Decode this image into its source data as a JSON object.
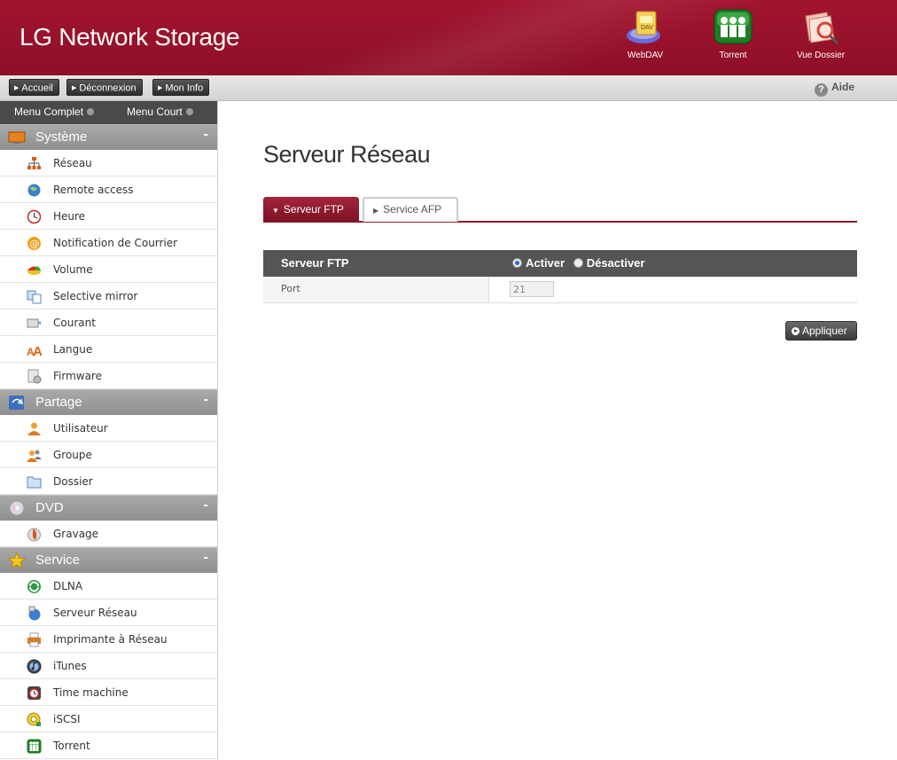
{
  "header": {
    "brand": "LG Network Storage",
    "shortcuts": [
      {
        "label": "WebDAV",
        "icon": "webdav-icon",
        "badge": "DAV"
      },
      {
        "label": "Torrent",
        "icon": "torrent-icon"
      },
      {
        "label": "Vue Dossier",
        "icon": "folder-view-icon"
      }
    ]
  },
  "toolbar": {
    "buttons": [
      "Accueil",
      "Déconnexion",
      "Mon Info"
    ],
    "help": "Aide"
  },
  "sidebar": {
    "menu_full": "Menu Complet",
    "menu_short": "Menu Court",
    "sections": [
      {
        "title": "Système",
        "icon": "monitor-icon",
        "items": [
          {
            "label": "Réseau",
            "icon": "network-icon"
          },
          {
            "label": "Remote access",
            "icon": "globe-icon"
          },
          {
            "label": "Heure",
            "icon": "clock-icon"
          },
          {
            "label": "Notification de Courrier",
            "icon": "at-icon"
          },
          {
            "label": "Volume",
            "icon": "volume-icon"
          },
          {
            "label": "Selective mirror",
            "icon": "mirror-icon"
          },
          {
            "label": "Courant",
            "icon": "power-icon"
          },
          {
            "label": "Langue",
            "icon": "language-icon"
          },
          {
            "label": "Firmware",
            "icon": "firmware-icon"
          }
        ]
      },
      {
        "title": "Partage",
        "icon": "share-icon",
        "items": [
          {
            "label": "Utilisateur",
            "icon": "user-icon"
          },
          {
            "label": "Groupe",
            "icon": "group-icon"
          },
          {
            "label": "Dossier",
            "icon": "folder-icon"
          }
        ]
      },
      {
        "title": "DVD",
        "icon": "disc-icon",
        "items": [
          {
            "label": "Gravage",
            "icon": "burn-icon"
          }
        ]
      },
      {
        "title": "Service",
        "icon": "star-icon",
        "items": [
          {
            "label": "DLNA",
            "icon": "dlna-icon"
          },
          {
            "label": "Serveur Réseau",
            "icon": "network-server-icon"
          },
          {
            "label": "Imprimante à Réseau",
            "icon": "printer-icon"
          },
          {
            "label": "iTunes",
            "icon": "itunes-icon"
          },
          {
            "label": "Time machine",
            "icon": "time-machine-icon"
          },
          {
            "label": "iSCSI",
            "icon": "iscsi-icon"
          },
          {
            "label": "Torrent",
            "icon": "torrent-icon"
          }
        ]
      }
    ],
    "collapse_symbol": "-"
  },
  "main": {
    "title": "Serveur Réseau",
    "tabs": [
      {
        "label": "Serveur FTP",
        "active": true
      },
      {
        "label": "Service AFP",
        "active": false
      }
    ],
    "ftp": {
      "header_label": "Serveur FTP",
      "enable_label": "Activer",
      "disable_label": "Désactiver",
      "selected": "Activer",
      "port_label": "Port",
      "port_value": "21"
    },
    "apply_label": "Appliquer"
  },
  "colors": {
    "header_red": "#9c1530",
    "tab_active": "#8e1a2b",
    "section_gray": "#999999"
  }
}
